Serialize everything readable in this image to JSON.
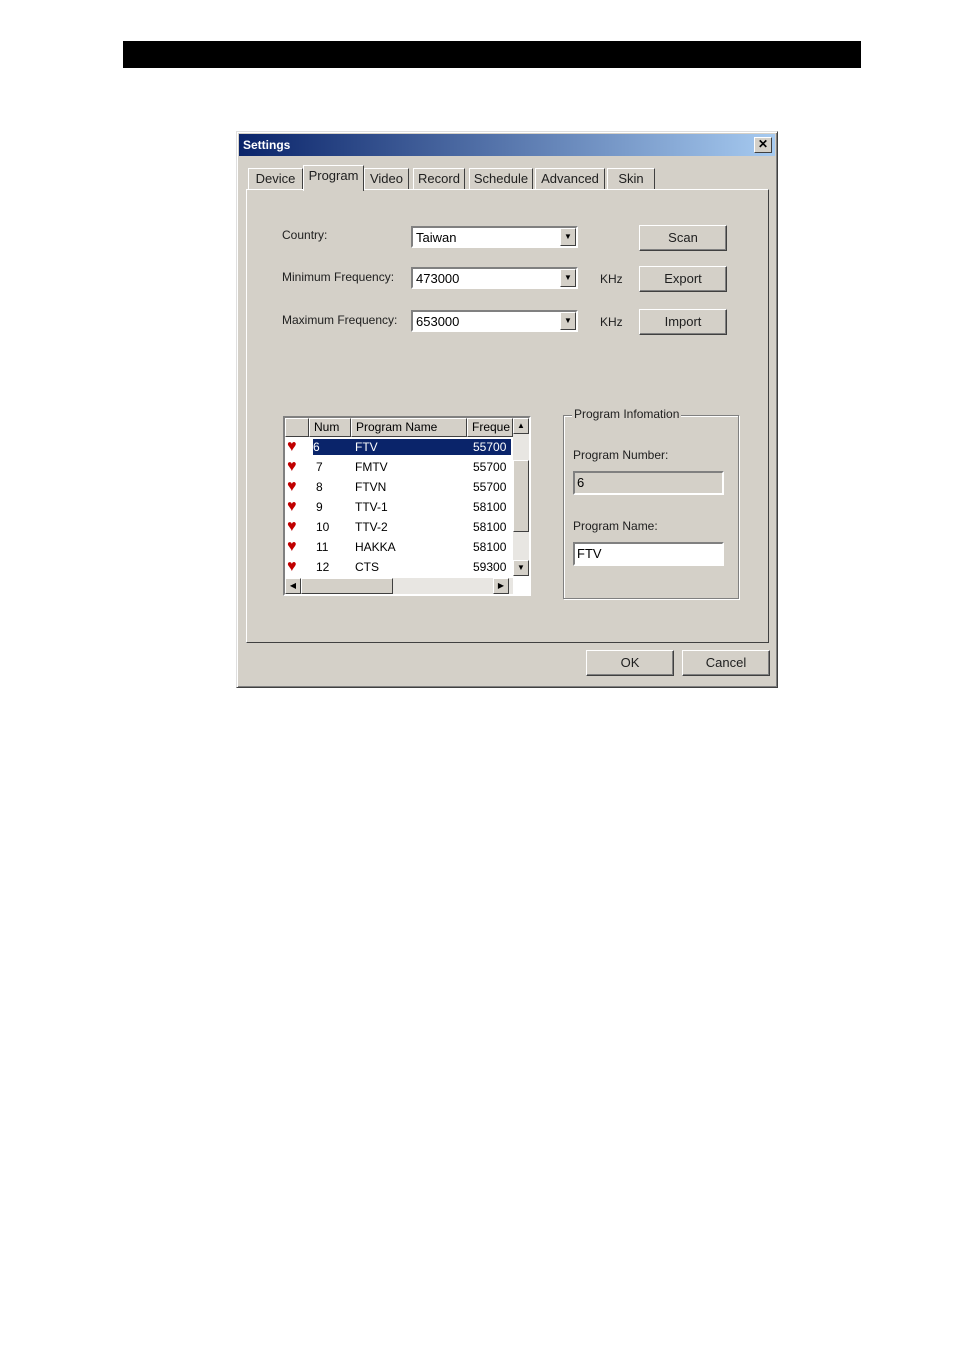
{
  "window": {
    "title": "Settings",
    "close_glyph": "✕"
  },
  "tabs": [
    {
      "label": "Device"
    },
    {
      "label": "Program",
      "active": true
    },
    {
      "label": "Video"
    },
    {
      "label": "Record"
    },
    {
      "label": "Schedule"
    },
    {
      "label": "Advanced"
    },
    {
      "label": "Skin"
    }
  ],
  "program": {
    "country_label": "Country:",
    "country_value": "Taiwan",
    "min_freq_label": "Minimum Frequency:",
    "min_freq_value": "473000",
    "max_freq_label": "Maximum Frequency:",
    "max_freq_value": "653000",
    "unit": "KHz",
    "scan_label": "Scan",
    "export_label": "Export",
    "import_label": "Import"
  },
  "channel_list": {
    "columns": [
      "Num",
      "Program Name",
      "Freque"
    ],
    "rows": [
      {
        "num": "6",
        "name": "FTV",
        "freq": "55700",
        "selected": true
      },
      {
        "num": "7",
        "name": "FMTV",
        "freq": "55700"
      },
      {
        "num": "8",
        "name": "FTVN",
        "freq": "55700"
      },
      {
        "num": "9",
        "name": "TTV-1",
        "freq": "58100"
      },
      {
        "num": "10",
        "name": "TTV-2",
        "freq": "58100"
      },
      {
        "num": "11",
        "name": "HAKKA",
        "freq": "58100"
      },
      {
        "num": "12",
        "name": "CTS",
        "freq": "59300"
      }
    ],
    "row_icon": "heart-icon"
  },
  "program_info": {
    "group_title": "Program Infomation",
    "number_label": "Program Number:",
    "number_value": "6",
    "name_label": "Program Name:",
    "name_value": "FTV"
  },
  "footer": {
    "ok_label": "OK",
    "cancel_label": "Cancel"
  },
  "colors": {
    "title_start": "#0a246a",
    "title_end": "#a6caf0",
    "face": "#d4d0c8",
    "selection": "#0a246a",
    "heart": "#c00000"
  }
}
